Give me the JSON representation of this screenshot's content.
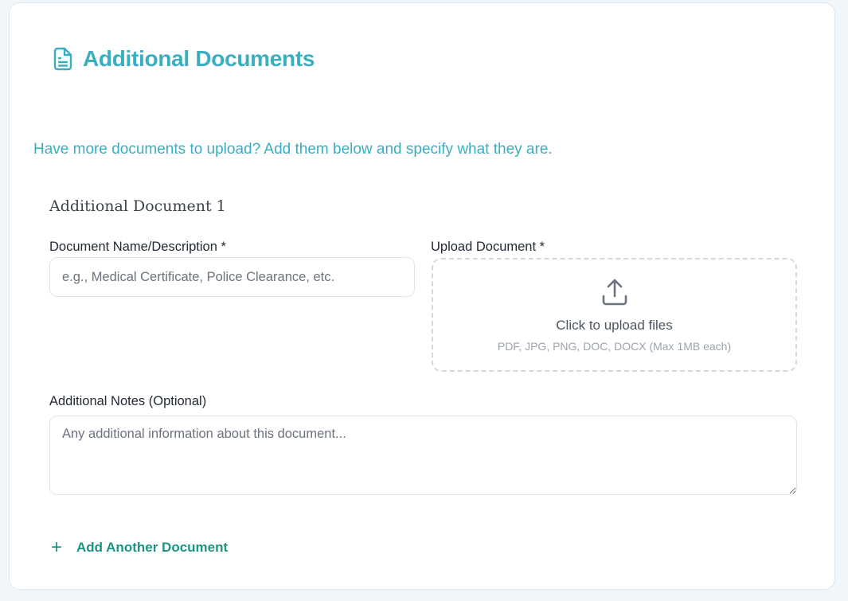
{
  "header": {
    "icon": "document-icon",
    "title": "Additional Documents"
  },
  "intro": "Have more documents to upload? Add them below and specify what they are.",
  "documents": [
    {
      "heading": "Additional Document 1",
      "name_label": "Document Name/Description *",
      "name_value": "",
      "name_placeholder": "e.g., Medical Certificate, Police Clearance, etc.",
      "upload_label": "Upload Document *",
      "upload_icon": "upload-icon",
      "upload_text": "Click to upload files",
      "upload_hint": "PDF, JPG, PNG, DOC, DOCX (Max 1MB each)",
      "notes_label": "Additional Notes (Optional)",
      "notes_value": "",
      "notes_placeholder": "Any additional information about this document..."
    }
  ],
  "add_another": {
    "icon": "plus-icon",
    "label": "Add Another Document"
  },
  "colors": {
    "accent_teal": "#3aaec1",
    "action_green": "#1c9483",
    "background": "#f1f6fb"
  }
}
